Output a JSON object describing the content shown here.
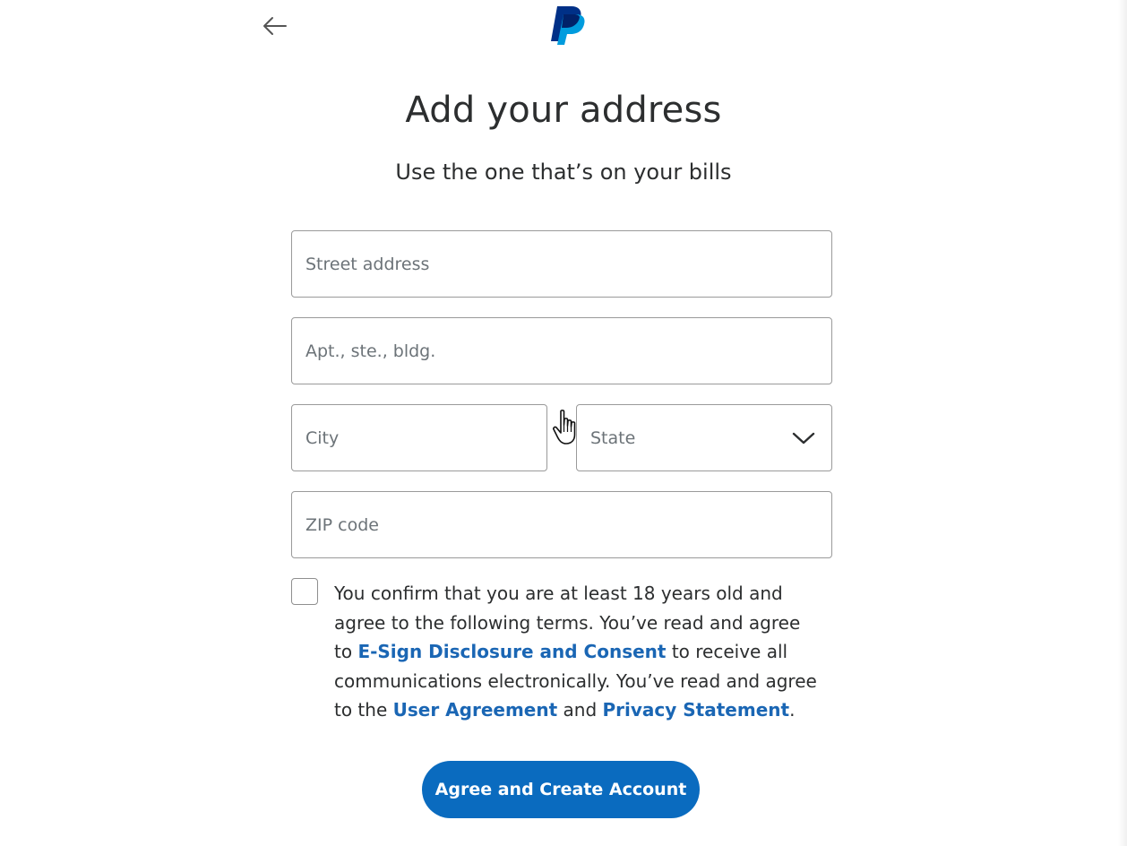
{
  "header": {
    "back_icon": "arrow-left-icon",
    "logo_icon": "paypal-logo-icon"
  },
  "page": {
    "title": "Add your address",
    "subtitle": "Use the one that’s on your bills"
  },
  "form": {
    "street": {
      "placeholder": "Street address",
      "value": ""
    },
    "apt": {
      "placeholder": "Apt., ste., bldg.",
      "value": ""
    },
    "city": {
      "placeholder": "City",
      "value": ""
    },
    "state": {
      "label": "State",
      "icon": "chevron-down-icon"
    },
    "zip": {
      "placeholder": "ZIP code",
      "value": ""
    }
  },
  "terms": {
    "checked": false,
    "text_1": "You confirm that you are at least 18 years old and agree to the following terms. You’ve read and agree to ",
    "link_esign": "E-Sign Disclosure and Consent",
    "text_2": " to receive all communications electronically. You’ve read and agree to the ",
    "link_user_agreement": "User Agreement",
    "text_3": " and ",
    "link_privacy": "Privacy Statement",
    "text_4": "."
  },
  "cta": {
    "label": "Agree and Create Account"
  },
  "colors": {
    "link": "#1a66b4",
    "button": "#0a6bbf",
    "paypal_dark": "#003087",
    "paypal_light": "#009cde"
  },
  "cursor": {
    "icon": "hand-pointer-icon"
  }
}
